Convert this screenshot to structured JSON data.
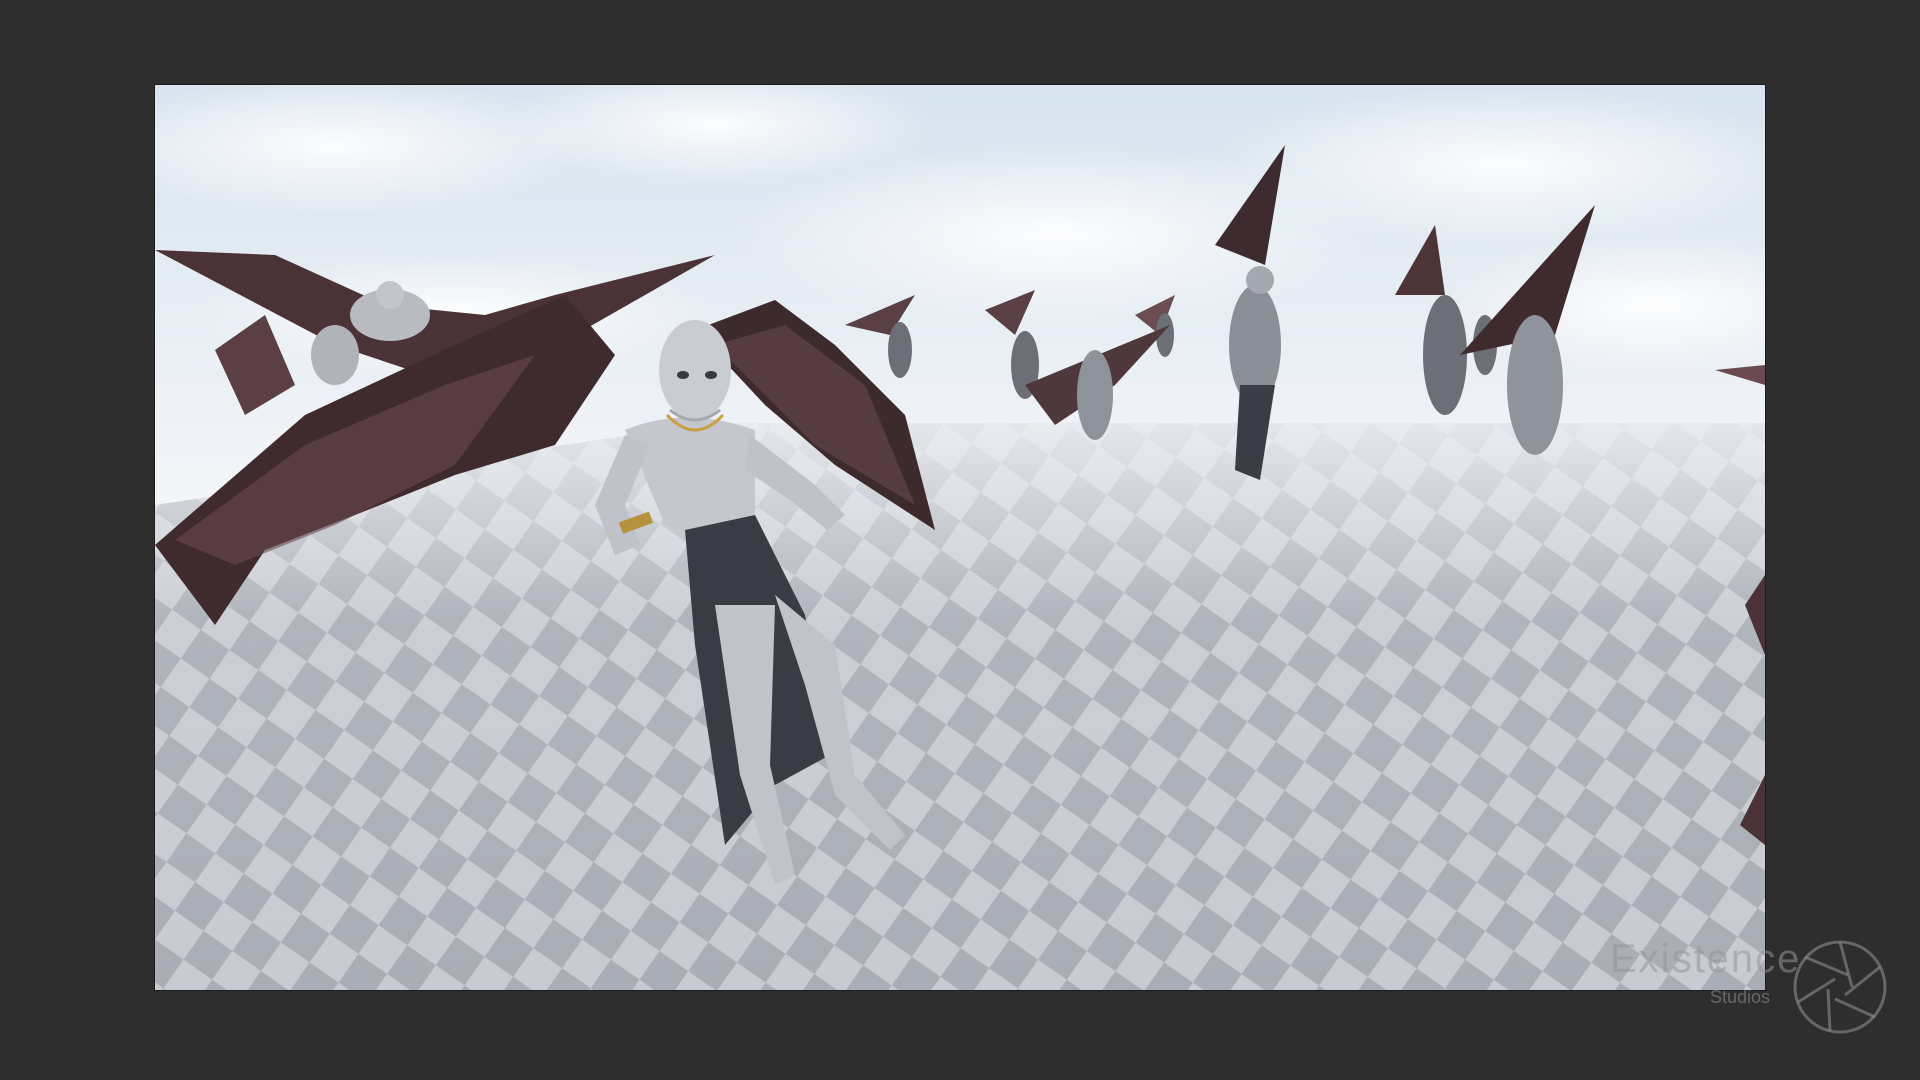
{
  "watermark": {
    "title": "Existence",
    "subtitle": "Studios",
    "logo_icon": "aperture-logo-icon"
  },
  "scene": {
    "sky_top": "#dfe8f2",
    "sky_bottom": "#f3f6f9",
    "floor_light": "#c5c8cf",
    "floor_dark": "#a7abb4",
    "wing_color": "#4a3438",
    "skin_color": "#c9ccd3",
    "cloth_color": "#3b3d46",
    "background": "#2e2e2e"
  }
}
